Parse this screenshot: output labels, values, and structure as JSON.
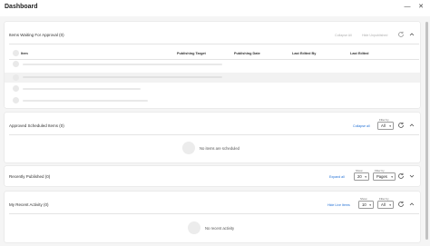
{
  "window": {
    "title": "Dashboard",
    "minimize_icon": "minimize-icon",
    "close_icon": "close-icon"
  },
  "panels": {
    "waiting": {
      "title": "Items Waiting For Approval (0)",
      "collapse_all": "Collapse All",
      "hide_unpublished": "Hide Unpublished",
      "columns": [
        "Item",
        "Publishing Target",
        "Publishing Date",
        "Last Edited By",
        "Last Edited"
      ]
    },
    "approved": {
      "title": "Approved Scheduled Items (0)",
      "collapse_all": "Collapse all",
      "filter_label": "Filter by",
      "filter_value": "All",
      "empty_text": "No items are scheduled"
    },
    "recent_published": {
      "title": "Recently Published (0)",
      "expand_all": "Expand all",
      "show_label": "Show",
      "show_value": "20",
      "filter_label": "Filter by",
      "filter_value": "Pages"
    },
    "my_activity": {
      "title": "My Recent Activity (0)",
      "hide_live": "Hide Live Items",
      "show_label": "Show",
      "show_value": "10",
      "filter_label": "Filter by",
      "filter_value": "All",
      "empty_text": "No recent activity"
    }
  },
  "colors": {
    "accent": "#1f6ed4",
    "muted": "#b0b0b0",
    "skeleton": "#e9e9e9"
  }
}
